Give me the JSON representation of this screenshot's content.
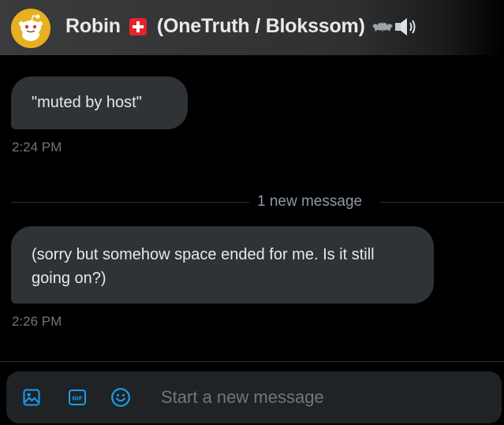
{
  "header": {
    "name": "Robin",
    "flag_icon": "swiss-flag-icon",
    "affiliation": "(OneTruth / Blokssom)",
    "trailing_icons": [
      "bat-icon",
      "speaker-icon"
    ],
    "avatar_icon": "snoo-avatar-icon"
  },
  "messages": [
    {
      "text": "\"muted by host\"",
      "time": "2:24 PM"
    },
    {
      "text": "(sorry but somehow space ended for me. Is it still going on?)",
      "time": "2:26 PM"
    }
  ],
  "divider": {
    "label": "1 new message"
  },
  "composer": {
    "placeholder": "Start a new message",
    "value": "",
    "icons": [
      "media-icon",
      "gif-icon",
      "emoji-icon"
    ]
  },
  "colors": {
    "accent": "#1d9bf0",
    "bubble": "#2f3336",
    "muted_text": "#71767b",
    "background": "#000000"
  }
}
